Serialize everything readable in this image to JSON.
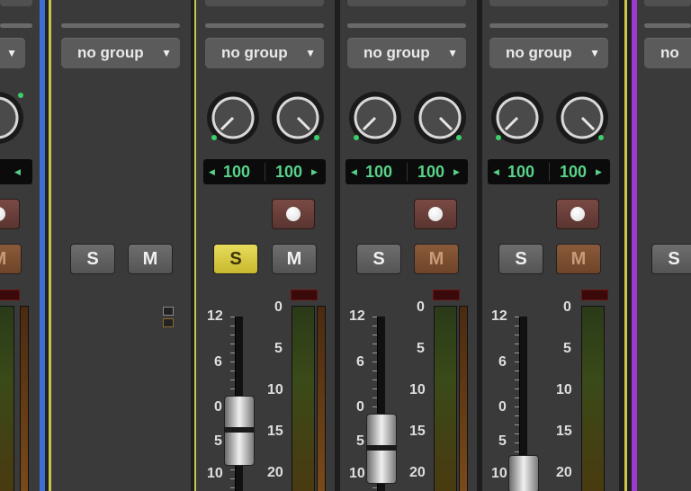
{
  "colors": {
    "pan_text": "#59d28a",
    "solo_active": "#e1d34b",
    "mute_dim": "#7f5030",
    "record_button": "#6a3e38",
    "divider_blue": "#3b6fd6",
    "divider_yellow": "#c9c44a",
    "divider_purple": "#9a3ad1"
  },
  "channels": [
    {
      "group": "",
      "pan_left": "",
      "pan_right": "",
      "solo": "",
      "mute": "M",
      "solo_state": "off",
      "mute_state": "dim"
    },
    {
      "group": "no group",
      "solo": "S",
      "mute": "M",
      "solo_state": "off",
      "mute_state": "off"
    },
    {
      "group": "no group",
      "pan_left": "100",
      "pan_right": "100",
      "solo": "S",
      "mute": "M",
      "solo_state": "on",
      "mute_state": "off",
      "fader_scale": [
        "12",
        "6",
        "0",
        "5",
        "10"
      ],
      "meter_scale": [
        "0",
        "5",
        "10",
        "15",
        "20"
      ],
      "fader_level_db": 0
    },
    {
      "group": "no group",
      "pan_left": "100",
      "pan_right": "100",
      "solo": "S",
      "mute": "M",
      "solo_state": "off",
      "mute_state": "dim",
      "fader_scale": [
        "12",
        "6",
        "0",
        "5",
        "10"
      ],
      "meter_scale": [
        "0",
        "5",
        "10",
        "15",
        "20"
      ],
      "fader_level_db": -5
    },
    {
      "group": "no group",
      "pan_left": "100",
      "pan_right": "100",
      "solo": "S",
      "mute": "M",
      "solo_state": "off",
      "mute_state": "dim",
      "fader_scale": [
        "12",
        "6",
        "0",
        "5",
        "10"
      ],
      "meter_scale": [
        "0",
        "5",
        "10",
        "15",
        "20"
      ],
      "fader_level_db": -10
    },
    {
      "group": "no",
      "solo": "S"
    }
  ]
}
